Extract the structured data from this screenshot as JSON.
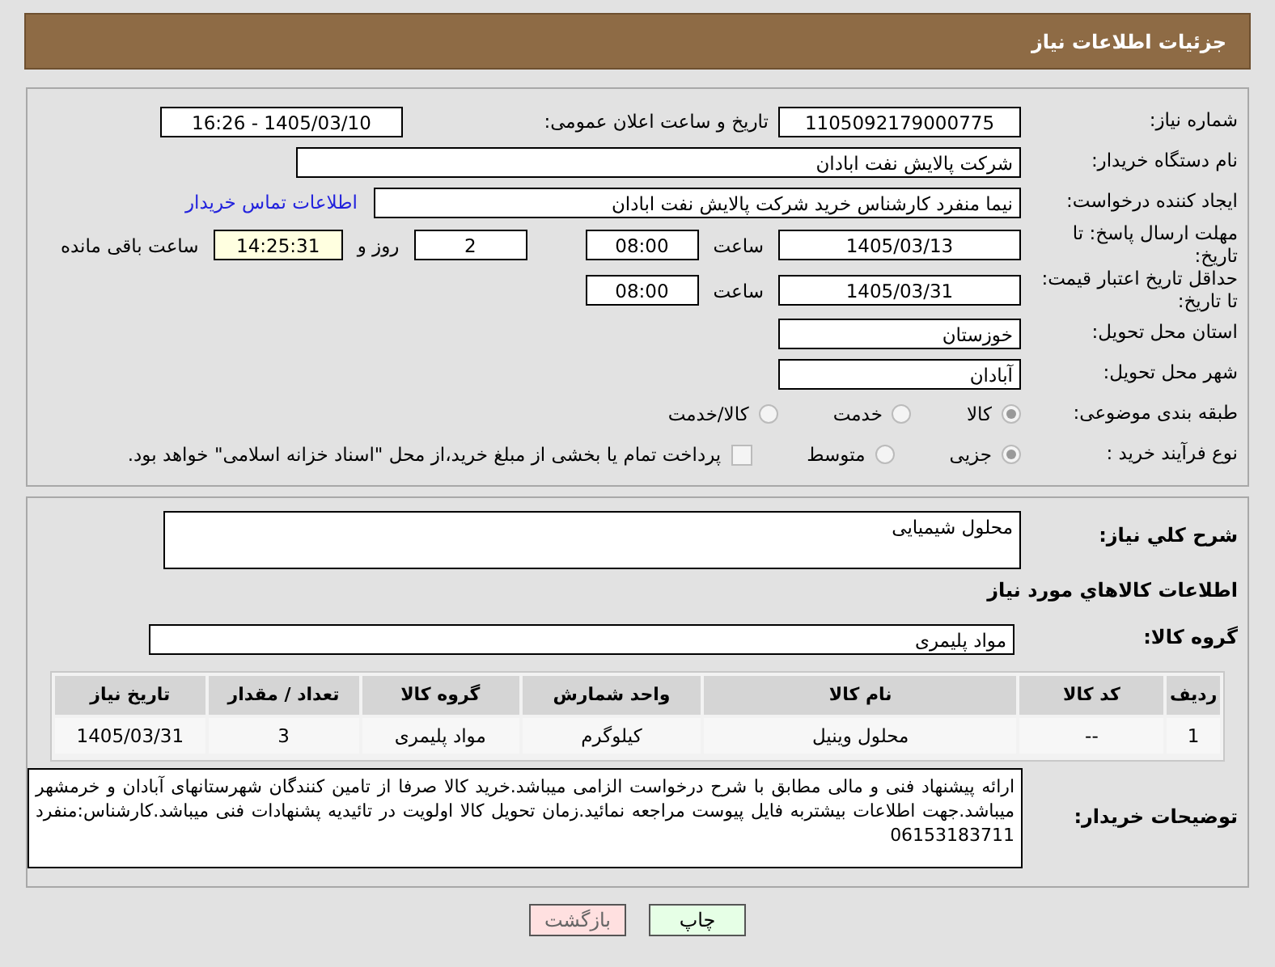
{
  "header": {
    "title": "جزئیات اطلاعات نیاز"
  },
  "need_number": {
    "label": "شماره نیاز:",
    "value": "1105092179000775"
  },
  "announce_datetime": {
    "label": "تاریخ و ساعت اعلان عمومی:",
    "value": "1405/03/10 - 16:26"
  },
  "buyer_org": {
    "label": "نام دستگاه خریدار:",
    "value": "شرکت پالایش نفت ابادان"
  },
  "requester": {
    "label": "ایجاد کننده درخواست:",
    "value": "نیما منفرد کارشناس خرید شرکت پالایش نفت ابادان",
    "link": "اطلاعات تماس خریدار"
  },
  "reply_deadline": {
    "label": "مهلت ارسال پاسخ: تا تاریخ:",
    "date": "1405/03/13",
    "time_label": "ساعت",
    "time": "08:00",
    "days": "2",
    "days_label": "روز و",
    "remaining": "14:25:31",
    "remaining_label": "ساعت باقی مانده"
  },
  "price_validity": {
    "label": "حداقل تاریخ اعتبار قیمت: تا تاریخ:",
    "date": "1405/03/31",
    "time_label": "ساعت",
    "time": "08:00"
  },
  "province": {
    "label": "استان محل تحویل:",
    "value": "خوزستان"
  },
  "city": {
    "label": "شهر محل تحویل:",
    "value": "آبادان"
  },
  "category": {
    "label": "طبقه بندی موضوعی:",
    "options": [
      {
        "label": "کالا",
        "selected": true
      },
      {
        "label": "خدمت",
        "selected": false
      },
      {
        "label": "کالا/خدمت",
        "selected": false
      }
    ]
  },
  "process": {
    "label": "نوع فرآیند خرید :",
    "options": [
      {
        "label": "جزیی",
        "selected": true
      },
      {
        "label": "متوسط",
        "selected": false
      }
    ],
    "treasury": {
      "checked": false,
      "label": "پرداخت تمام یا بخشی از مبلغ خرید،از محل \"اسناد خزانه اسلامی\" خواهد بود."
    }
  },
  "description": {
    "label": "شرح كلي نياز:",
    "value": "محلول شیمیایی"
  },
  "goods_title": "اطلاعات كالاهاي مورد نياز",
  "goods_group": {
    "label": "گروه کالا:",
    "value": "مواد پلیمری"
  },
  "table": {
    "columns": [
      "ردیف",
      "کد کالا",
      "نام کالا",
      "واحد شمارش",
      "گروه کالا",
      "تعداد / مقدار",
      "تاریخ نیاز"
    ],
    "rows": [
      [
        "1",
        "--",
        "محلول وینیل",
        "کیلوگرم",
        "مواد پلیمری",
        "3",
        "1405/03/31"
      ]
    ]
  },
  "buyer_notes": {
    "label": "توضیحات خریدار:",
    "value": "ارائه پیشنهاد فنی و مالی مطابق با شرح درخواست الزامی میباشد.خرید کالا صرفا از تامین کنندگان شهرستانهای آبادان و خرمشهر میباشد.جهت اطلاعات بیشتربه فایل پیوست مراجعه نمائید.زمان تحویل کالا اولویت در تائیدیه پشنهادات فنی میباشد.کارشناس:منفرد 06153183711"
  },
  "buttons": [
    {
      "kind": "print",
      "label": "چاپ"
    },
    {
      "kind": "back",
      "label": "بازگشت"
    }
  ]
}
